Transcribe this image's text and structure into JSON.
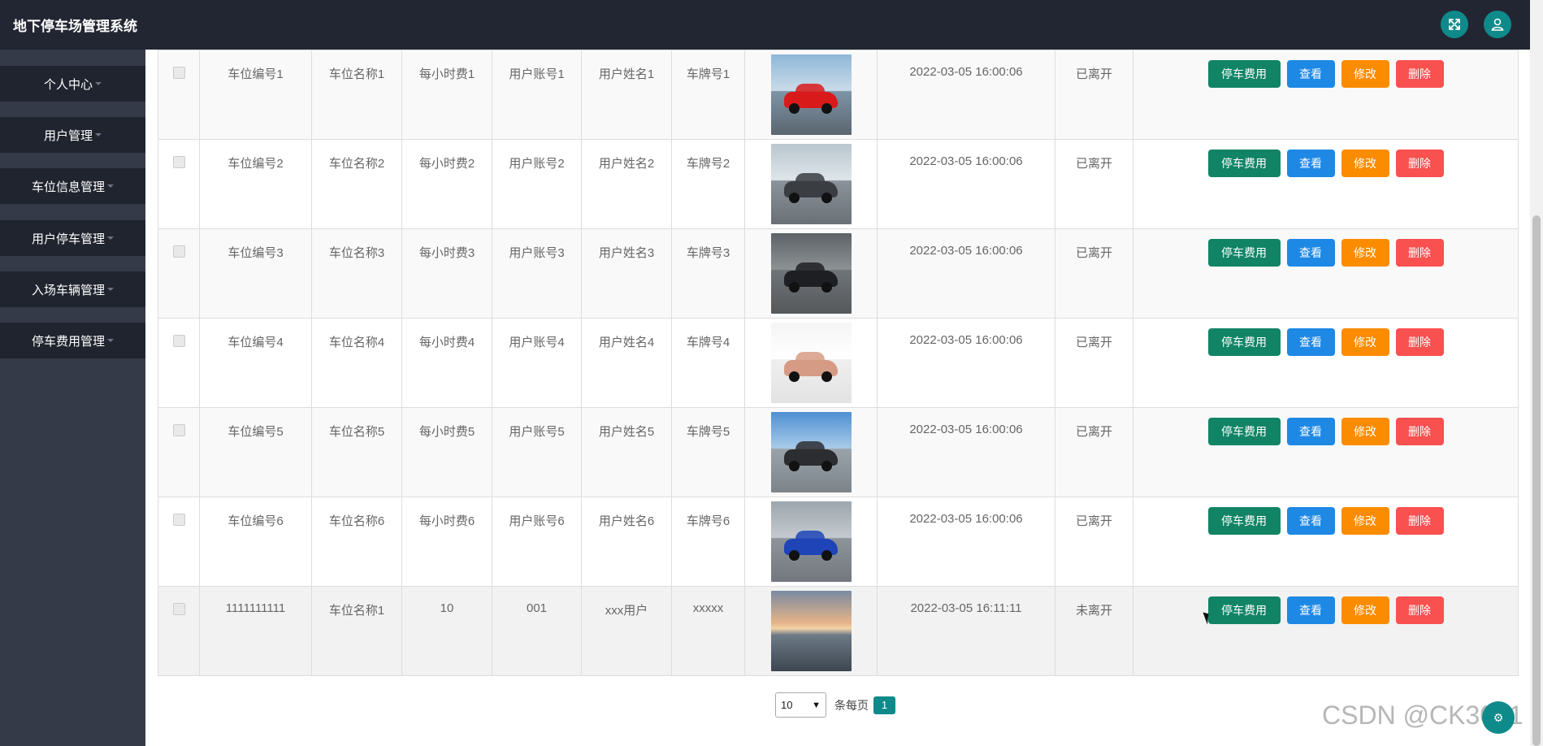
{
  "app": {
    "title": "地下停车场管理系统"
  },
  "header": {
    "fullscreen_icon": "fullscreen-icon",
    "user_icon": "user-icon"
  },
  "sidebar": {
    "items": [
      {
        "label": "个人中心"
      },
      {
        "label": "用户管理"
      },
      {
        "label": "车位信息管理"
      },
      {
        "label": "用户停车管理"
      },
      {
        "label": "入场车辆管理"
      },
      {
        "label": "停车费用管理"
      }
    ]
  },
  "actions": {
    "fee": "停车费用",
    "view": "查看",
    "edit": "修改",
    "delete": "删除"
  },
  "colors": {
    "header_bg": "#222632",
    "sidebar_bg": "#343a48",
    "accent": "#0f8a8a",
    "fee_button": "#128466",
    "view_button": "#1e88e5",
    "edit_button": "#fb8c00",
    "delete_button": "#f95050"
  },
  "rows": [
    {
      "spot_no": "车位编号1",
      "spot_name": "车位名称1",
      "hourly_fee": "每小时费1",
      "account": "用户账号1",
      "user_name": "用户姓名1",
      "plate": "车牌号1",
      "photo": "car-photo-red-sports",
      "time": "2022-03-05 16:00:06",
      "status": "已离开"
    },
    {
      "spot_no": "车位编号2",
      "spot_name": "车位名称2",
      "hourly_fee": "每小时费2",
      "account": "用户账号2",
      "user_name": "用户姓名2",
      "plate": "车牌号2",
      "photo": "car-photo-dark-sedan",
      "time": "2022-03-05 16:00:06",
      "status": "已离开"
    },
    {
      "spot_no": "车位编号3",
      "spot_name": "车位名称3",
      "hourly_fee": "每小时费3",
      "account": "用户账号3",
      "user_name": "用户姓名3",
      "plate": "车牌号3",
      "photo": "car-photo-black-sedan",
      "time": "2022-03-05 16:00:06",
      "status": "已离开"
    },
    {
      "spot_no": "车位编号4",
      "spot_name": "车位名称4",
      "hourly_fee": "每小时费4",
      "account": "用户账号4",
      "user_name": "用户姓名4",
      "plate": "车牌号4",
      "photo": "car-photo-rose-coupe",
      "time": "2022-03-05 16:00:06",
      "status": "已离开"
    },
    {
      "spot_no": "车位编号5",
      "spot_name": "车位名称5",
      "hourly_fee": "每小时费5",
      "account": "用户账号5",
      "user_name": "用户姓名5",
      "plate": "车牌号5",
      "photo": "car-photo-bridge-sedan",
      "time": "2022-03-05 16:00:06",
      "status": "已离开"
    },
    {
      "spot_no": "车位编号6",
      "spot_name": "车位名称6",
      "hourly_fee": "每小时费6",
      "account": "用户账号6",
      "user_name": "用户姓名6",
      "plate": "车牌号6",
      "photo": "car-photo-blue-coupe",
      "time": "2022-03-05 16:00:06",
      "status": "已离开"
    },
    {
      "spot_no": "1111111111",
      "spot_name": "车位名称1",
      "hourly_fee": "10",
      "account": "001",
      "user_name": "xxx用户",
      "plate": "xxxxx",
      "photo": "photo-sunset-lake",
      "time": "2022-03-05 16:11:11",
      "status": "未离开"
    }
  ],
  "pagination": {
    "page_size": "10",
    "per_page_label": "条每页",
    "current_page": "1"
  },
  "watermark": "CSDN @CK3041"
}
